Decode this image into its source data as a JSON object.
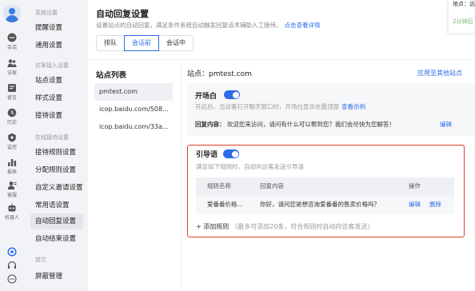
{
  "rail": {
    "items": [
      {
        "label": "会话",
        "icon": "chat-icon"
      },
      {
        "label": "访客",
        "icon": "visitors-icon"
      },
      {
        "label": "留言",
        "icon": "message-icon"
      },
      {
        "label": "历史",
        "icon": "history-icon"
      },
      {
        "label": "监控",
        "icon": "monitor-icon"
      },
      {
        "label": "报表",
        "icon": "report-icon"
      },
      {
        "label": "客服",
        "icon": "agent-icon"
      },
      {
        "label": "机器人",
        "icon": "robot-icon"
      }
    ]
  },
  "sidebar": {
    "groups": [
      "系统设置",
      "访客接入设置",
      "在线接待设置",
      "其它"
    ],
    "items": [
      "提醒设置",
      "通用设置",
      "站点设置",
      "样式设置",
      "接待设置",
      "接待规则设置",
      "分配规则设置",
      "自定义邀请设置",
      "常用语设置",
      "自动回复设置",
      "自动结束设置",
      "屏蔽管理"
    ],
    "active": "自动回复设置"
  },
  "header": {
    "title": "自动回复设置",
    "subtitle": "设置站点的自动回复，满足条件系统自动触发回复话术辅助人工接待。",
    "detail_link": "点击查看详情"
  },
  "tabs": [
    "排队",
    "会话前",
    "会话中"
  ],
  "active_tab": "会话前",
  "stations": {
    "title": "站点列表",
    "items": [
      "pmtest.com",
      "icop.baidu.com/508...",
      "icop.baidu.com/33a..."
    ]
  },
  "site": {
    "label": "站点：",
    "name": "pmtest.com",
    "apply_link": "应用至其他站点"
  },
  "opening": {
    "title": "开场白",
    "enabled": true,
    "desc": "开启后，当访客打开聊天窗口时，开场白显示在最顶部",
    "example_link": "查看示例",
    "reply_label": "回复内容：",
    "reply_text": "欢迎您来访问，请问有什么可以帮到您？我们会尽快为您解答！",
    "edit": "编辑"
  },
  "guide": {
    "title": "引导语",
    "enabled": true,
    "desc": "满足如下规则时，自动向访客发送引导语",
    "columns": [
      "规则名称",
      "回复内容",
      "操作"
    ],
    "rows": [
      {
        "name": "爱番番价格...",
        "reply": "你好，请问您是想咨询爱番番的售卖价格吗？",
        "edit": "编辑",
        "delete": "删除"
      }
    ],
    "add_rule": "+ 添加规则",
    "add_hint": "（最多可添加20条，符合规则时自动向访客发送）"
  },
  "popup": {
    "line1": "地点：远",
    "line2": "2分钟后"
  },
  "colors": {
    "accent": "#2b6ce8",
    "highlight_border": "#e23b2e",
    "success": "#6db36d"
  }
}
